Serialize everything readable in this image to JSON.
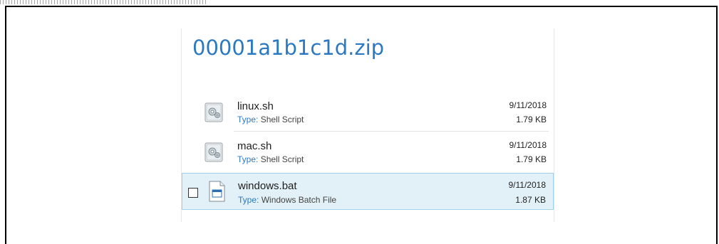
{
  "archive": {
    "title": "00001a1b1c1d.zip"
  },
  "files": [
    {
      "name": "linux.sh",
      "type_label": "Type:",
      "type": "Shell Script",
      "date": "9/11/2018",
      "size": "1.79 KB",
      "icon": "shell-script-icon"
    },
    {
      "name": "mac.sh",
      "type_label": "Type:",
      "type": "Shell Script",
      "date": "9/11/2018",
      "size": "1.79 KB",
      "icon": "shell-script-icon"
    },
    {
      "name": "windows.bat",
      "type_label": "Type:",
      "type": "Windows Batch File",
      "date": "9/11/2018",
      "size": "1.87 KB",
      "icon": "batch-file-icon",
      "selected": true
    }
  ],
  "colors": {
    "title": "#2b79c2",
    "selection_bg": "#e2f0f7",
    "selection_border": "#9fd2ea"
  }
}
